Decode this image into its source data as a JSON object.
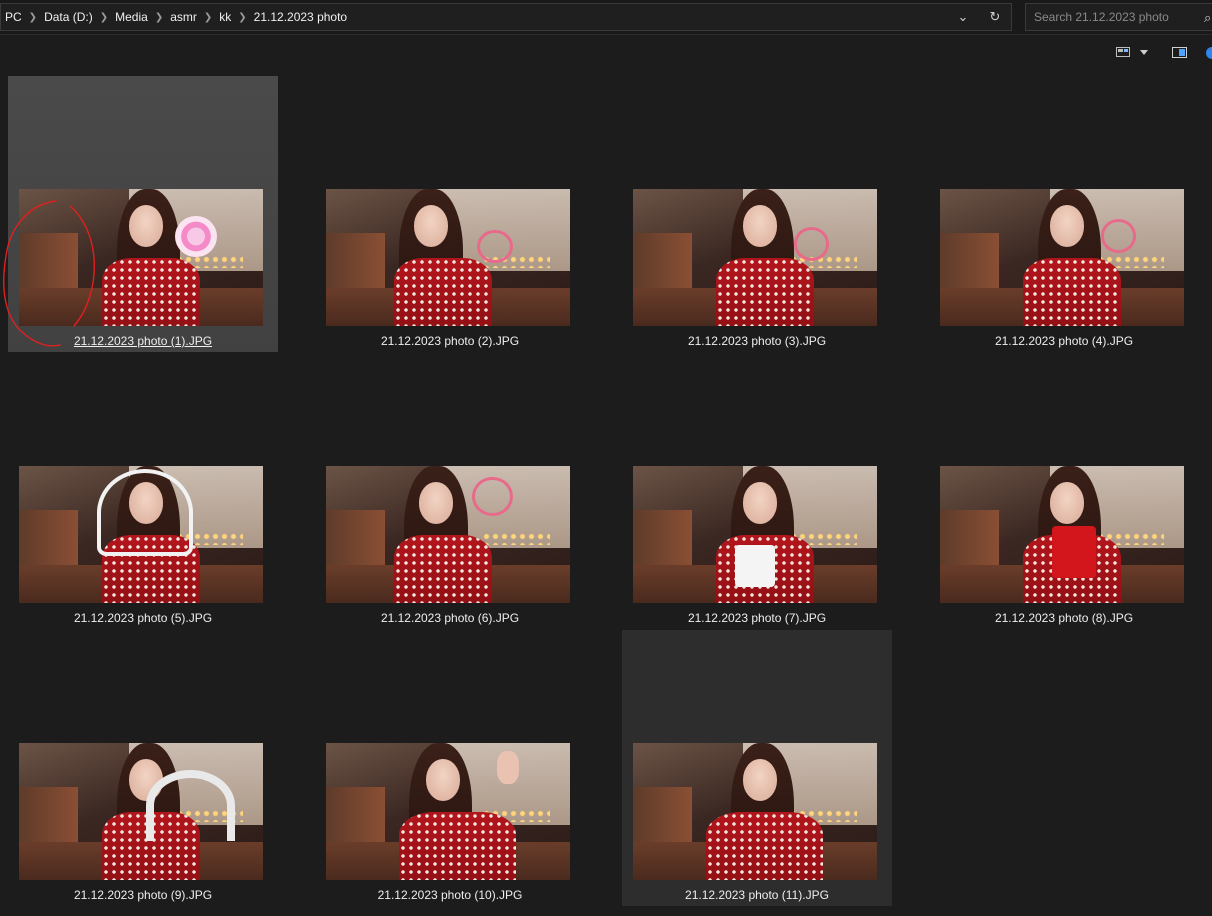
{
  "address": {
    "crumbs": [
      "PC",
      "Data (D:)",
      "Media",
      "asmr",
      "kk",
      "21.12.2023 photo"
    ]
  },
  "search": {
    "placeholder": "Search 21.12.2023 photo"
  },
  "icons": {
    "dropdown": "chevron-down-icon",
    "refresh": "refresh-icon",
    "search": "search-icon",
    "view": "view-options-icon",
    "pane": "details-pane-icon",
    "info": "info-icon"
  },
  "files": [
    {
      "name": "21.12.2023 photo (1).JPG",
      "state": "selected"
    },
    {
      "name": "21.12.2023 photo (2).JPG",
      "state": "normal"
    },
    {
      "name": "21.12.2023 photo (3).JPG",
      "state": "normal"
    },
    {
      "name": "21.12.2023 photo (4).JPG",
      "state": "normal"
    },
    {
      "name": "21.12.2023 photo (5).JPG",
      "state": "normal"
    },
    {
      "name": "21.12.2023 photo (6).JPG",
      "state": "normal"
    },
    {
      "name": "21.12.2023 photo (7).JPG",
      "state": "normal"
    },
    {
      "name": "21.12.2023 photo (8).JPG",
      "state": "normal"
    },
    {
      "name": "21.12.2023 photo (9).JPG",
      "state": "normal"
    },
    {
      "name": "21.12.2023 photo (10).JPG",
      "state": "normal"
    },
    {
      "name": "21.12.2023 photo (11).JPG",
      "state": "hover"
    }
  ],
  "colors": {
    "background": "#1c1c1c",
    "selected_tile": "#4a4a4a",
    "hover_tile": "#2d2d2d",
    "annotation": "#e0201f",
    "accent": "#2f86e8"
  }
}
